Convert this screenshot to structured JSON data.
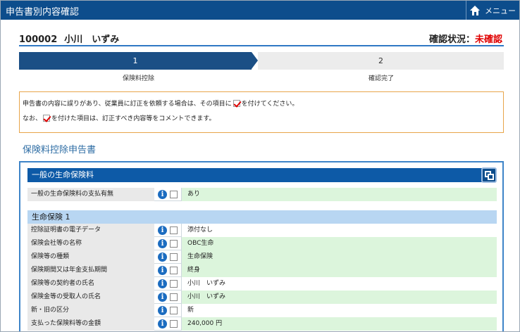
{
  "window": {
    "title": "申告書別内容確認",
    "menu_label": "メニュー"
  },
  "employee": {
    "id": "100002",
    "name": "小川　いずみ"
  },
  "confirm_status": {
    "label": "確認状況：",
    "value": "未確認",
    "value_color": "#e00000"
  },
  "steps": [
    {
      "number": "1",
      "label": "保険料控除",
      "active": true
    },
    {
      "number": "2",
      "label": "確認完了",
      "active": false
    }
  ],
  "notice": {
    "line1_before": "申告書の内容に誤りがあり、従業員に訂正を依頼する場合は、その項目に",
    "line1_after": "を付けてください。",
    "line2_before": "なお、",
    "line2_after": "を付けた項目は、訂正すべき内容等をコメントできます。"
  },
  "section_title": "保険料控除申告書",
  "group": {
    "title": "一般の生命保険料",
    "payment_row": {
      "label": "一般の生命保険料の支払有無",
      "value": "あり"
    },
    "subgroup_title": "生命保険 1",
    "rows": [
      {
        "label": "控除証明書の電子データ",
        "value": "添付なし",
        "bg": "white"
      },
      {
        "label": "保険会社等の名称",
        "value": "OBC生命",
        "bg": "green"
      },
      {
        "label": "保険等の種類",
        "value": "生命保険",
        "bg": "green"
      },
      {
        "label": "保険期間又は年金支払期間",
        "value": "終身",
        "bg": "green"
      },
      {
        "label": "保険等の契約者の氏名",
        "value": "小川　いずみ",
        "bg": "white"
      },
      {
        "label": "保険金等の受取人の氏名",
        "value": "小川　いずみ",
        "bg": "green"
      },
      {
        "label": "新・旧の区分",
        "value": "新",
        "bg": "white"
      },
      {
        "label": "支払った保険料等の金額",
        "value": "240,000 円",
        "bg": "green"
      }
    ]
  },
  "icons": {
    "home": "home-icon",
    "info": "info-icon",
    "checkbox": "checkbox",
    "collapse": "collapse-icon"
  },
  "colors": {
    "titlebar": "#0d4d8c",
    "active_step": "#1b4f85",
    "notice_border": "#e8a54a",
    "value_green": "#dcf5dc",
    "group_header": "#0d5aa7",
    "subgroup_header": "#b8d6f2"
  }
}
